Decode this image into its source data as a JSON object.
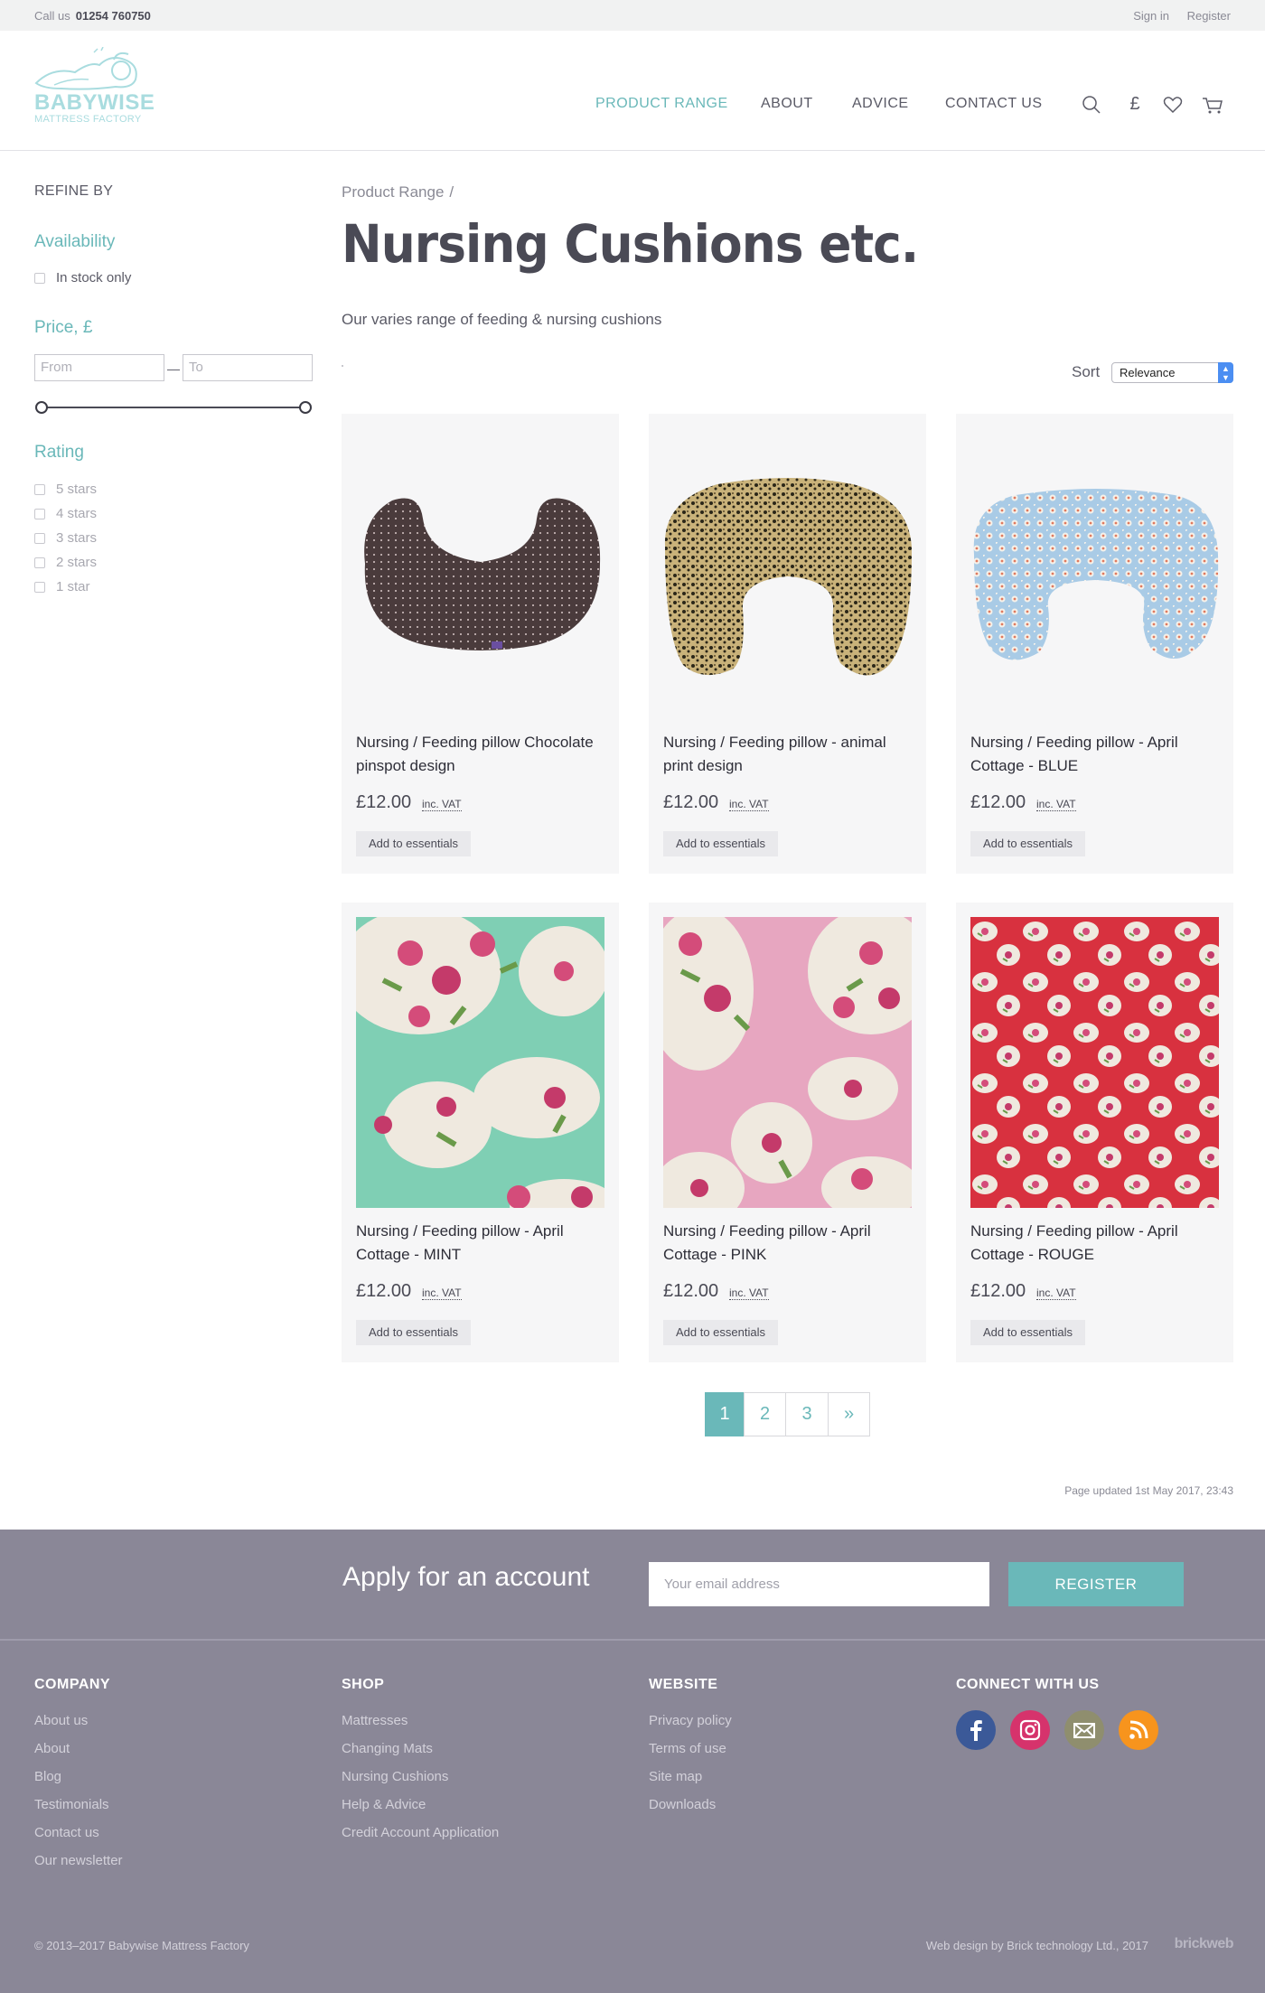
{
  "topbar": {
    "call_label": "Call us",
    "phone": "01254 760750",
    "sign_in": "Sign in",
    "register": "Register"
  },
  "logo": {
    "line1": "BABYWISE",
    "line2": "MATTRESS FACTORY"
  },
  "nav": {
    "product_range": "PRODUCT RANGE",
    "about": "ABOUT",
    "advice": "ADVICE",
    "contact": "CONTACT US",
    "currency_symbol": "£"
  },
  "sidebar": {
    "refine": "REFINE BY",
    "availability": {
      "title": "Availability",
      "in_stock": "In stock only"
    },
    "price": {
      "title": "Price, £",
      "from_placeholder": "From",
      "to_placeholder": "To",
      "dash": "—"
    },
    "rating": {
      "title": "Rating",
      "options": [
        "5 stars",
        "4 stars",
        "3 stars",
        "2 stars",
        "1 star"
      ]
    }
  },
  "main": {
    "breadcrumb": "Product Range",
    "breadcrumb_sep": "/",
    "title": "Nursing Cushions etc.",
    "description": "Our varies range of feeding & nursing cushions",
    "sort_label": "Sort",
    "sort_value": "Relevance"
  },
  "products": [
    {
      "name": "Nursing / Feeding pillow Chocolate pinspot design",
      "price": "£12.00",
      "vat": "inc. VAT",
      "button": "Add to essentials",
      "image": "brown-pinspot-pillow"
    },
    {
      "name": "Nursing / Feeding pillow - animal print design",
      "price": "£12.00",
      "vat": "inc. VAT",
      "button": "Add to essentials",
      "image": "leopard-print-pillow"
    },
    {
      "name": "Nursing / Feeding pillow - April Cottage - BLUE",
      "price": "£12.00",
      "vat": "inc. VAT",
      "button": "Add to essentials",
      "image": "blue-floral-pillow"
    },
    {
      "name": "Nursing / Feeding pillow - April Cottage - MINT",
      "price": "£12.00",
      "vat": "inc. VAT",
      "button": "Add to essentials",
      "image": "mint-rose-fabric"
    },
    {
      "name": "Nursing / Feeding pillow - April Cottage - PINK",
      "price": "£12.00",
      "vat": "inc. VAT",
      "button": "Add to essentials",
      "image": "pink-rose-fabric"
    },
    {
      "name": "Nursing / Feeding pillow - April Cottage - ROUGE",
      "price": "£12.00",
      "vat": "inc. VAT",
      "button": "Add to essentials",
      "image": "red-rose-fabric"
    }
  ],
  "pagination": {
    "pages": [
      "1",
      "2",
      "3"
    ],
    "next": "»",
    "current": "1"
  },
  "updated": "Page updated 1st May 2017, 23:43",
  "footer": {
    "apply": "Apply for an account",
    "email_placeholder": "Your email address",
    "register": "REGISTER",
    "company": {
      "title": "COMPANY",
      "links": [
        "About us",
        "About",
        "Blog",
        "Testimonials",
        "Contact us",
        "Our newsletter"
      ]
    },
    "shop": {
      "title": "SHOP",
      "links": [
        "Mattresses",
        "Changing Mats",
        "Nursing Cushions",
        "Help & Advice",
        "Credit Account Application"
      ]
    },
    "website": {
      "title": "WEBSITE",
      "links": [
        "Privacy policy",
        "Terms of use",
        "Site map",
        "Downloads"
      ]
    },
    "connect": {
      "title": "CONNECT WITH US",
      "icons": [
        "facebook-icon",
        "instagram-icon",
        "email-icon",
        "rss-icon"
      ]
    },
    "copyright": "© 2013–2017  Babywise Mattress Factory",
    "webdesign": "Web design by Brick technology Ltd., 2017",
    "brand": "brickweb"
  },
  "colors": {
    "accent": "#6ab8b9",
    "footer_bg": "#8a8797",
    "facebook": "#3b5998",
    "instagram": "#d6336c",
    "email": "#8f8e6e",
    "rss": "#f7941d"
  }
}
